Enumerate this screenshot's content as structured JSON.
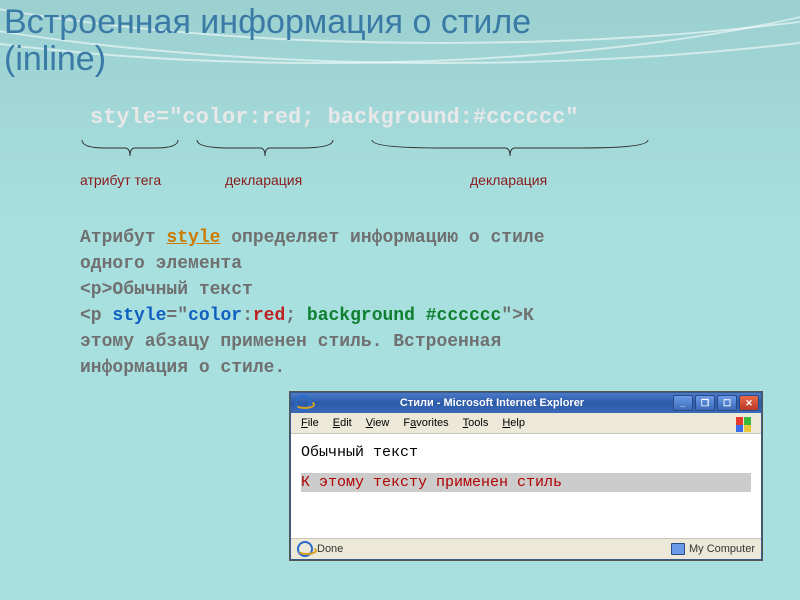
{
  "title_line1": "Встроенная информация о стиле",
  "title_line2": "(inline)",
  "code": {
    "full": "style=\"color:red; background:#cccccc\"",
    "attr": "style=",
    "val_open": "\"",
    "decl1_prop": "color",
    "decl1_val": "red",
    "decl2_prop": "background",
    "decl2_val": "#cccccc",
    "val_close": "\""
  },
  "brace_labels": {
    "attr": "атрибут тега",
    "decl1": "декларация",
    "decl2": "декларация"
  },
  "body": {
    "l1a": "Атрибут ",
    "l1_style": "style",
    "l1b": " определяет информацию о стиле",
    "l2": "одного элемента",
    "l3": "<p>Обычный текст",
    "l4_open": "<p ",
    "l4_style": "style",
    "l4_eq": "=",
    "l4_q1": "\"",
    "l4_prop1": "color",
    "l4_colon": ":",
    "l4_val1": "red",
    "l4_semi": "; ",
    "l4_prop2": "background",
    "l4_sp": " ",
    "l4_val2": "#cccccc",
    "l4_q2": "\"",
    "l4_close": ">К",
    "l5": "этому абзацу применен стиль. Встроенная",
    "l6": "информация о стиле."
  },
  "ie": {
    "title": "Стили - Microsoft Internet Explorer",
    "menu": {
      "file": "File",
      "edit": "Edit",
      "view": "View",
      "fav": "Favorites",
      "tools": "Tools",
      "help": "Help"
    },
    "content_plain": "Обычный текст",
    "content_styled": "К этому тексту применен стиль",
    "status_done": "Done",
    "status_zone": "My Computer"
  }
}
